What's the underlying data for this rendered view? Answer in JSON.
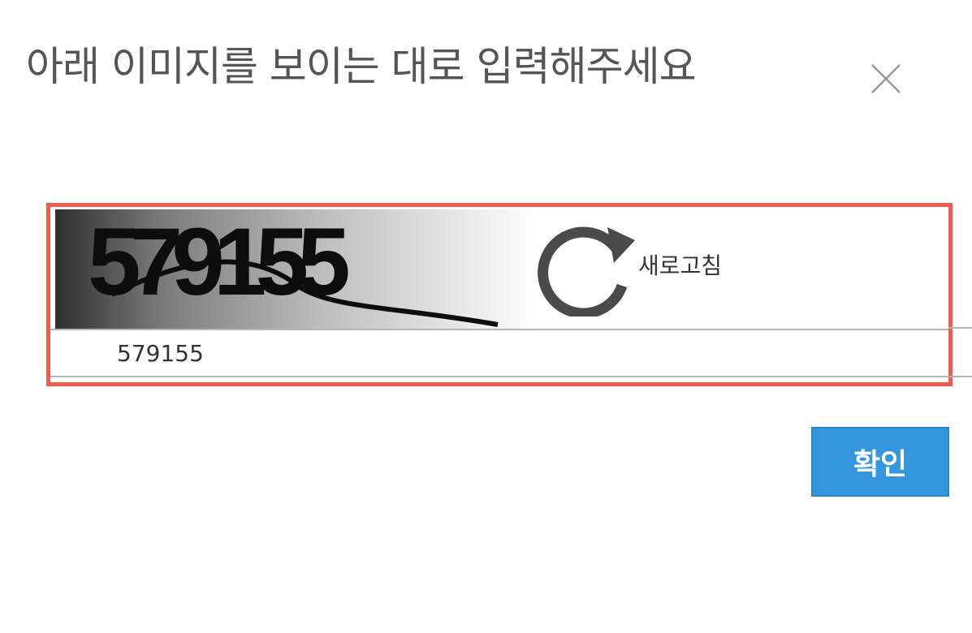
{
  "dialog": {
    "title": "아래 이미지를 보이는 대로 입력해주세요",
    "close_icon": "close-icon"
  },
  "captcha": {
    "image_text": "579155",
    "refresh_icon": "refresh-icon",
    "refresh_label": "새로고침",
    "input_value": "579155"
  },
  "actions": {
    "confirm_label": "확인"
  },
  "colors": {
    "highlight_border": "#f05a4f",
    "confirm_bg": "#3497de",
    "title_text": "#555555"
  }
}
